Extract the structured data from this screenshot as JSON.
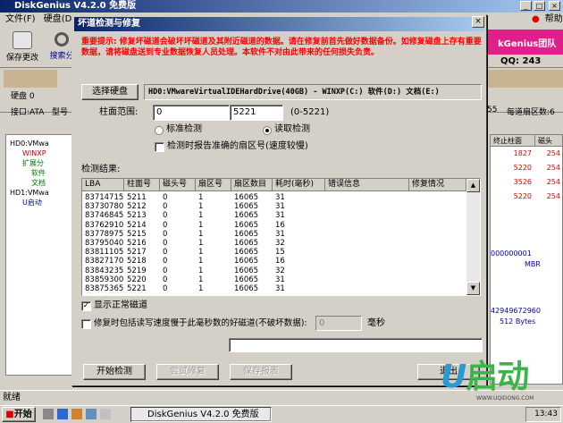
{
  "app": {
    "title": "DiskGenius V4.2.0 免费版",
    "menu": [
      "文件(F)",
      "硬盘(D)"
    ],
    "help": "帮助",
    "tools": [
      "保存更改",
      "搜索分"
    ],
    "disk_label": "硬盘 0",
    "iface": "接口:ATA",
    "model": "型号",
    "banner_text": "kGenius团队",
    "qq": "QQ: 243",
    "right_cols": [
      "终止柱面",
      "磁头"
    ],
    "right_rows": [
      [
        "1827",
        "254"
      ],
      [
        "5220",
        "254"
      ],
      [
        "3526",
        "254"
      ],
      [
        "5220",
        "254"
      ]
    ],
    "right_extra": [
      "55",
      "每道扇区数:6"
    ],
    "right_info": [
      "000000001",
      "MBR",
      "42949672960",
      "512 Bytes"
    ],
    "tree": [
      "HD0:VMwa",
      "WINXP",
      "扩展分",
      "软件",
      "文档",
      "HD1:VMwa",
      "U启动"
    ],
    "status": "就绪"
  },
  "dialog": {
    "title": "坏道检测与修复",
    "close": "×",
    "warning": "重要提示: 修复坏磁道会破坏坏磁道及其附近磁道的数据。请在修复前首先做好数据备份。如修复磁盘上存有重要数据，请将磁盘送到专业数据恢复人员处理。本软件不对由此带来的任何损失负责。",
    "select_disk": "选择硬盘",
    "disk_name": "HD0:VMwareVirtualIDEHardDrive(40GB) - WINXP(C:) 软件(D:) 文档(E:)",
    "cyl_label": "柱面范围:",
    "cyl_from": "0",
    "arrow": "-->",
    "cyl_to": "5221",
    "cyl_range": "(0-5221)",
    "mode_std": "标准检测",
    "mode_read": "读取检测",
    "report_slow": "检测时报告准确的扇区号(速度较慢)",
    "result_label": "检测结果:",
    "columns": [
      "LBA",
      "柱面号",
      "磁头号",
      "扇区号",
      "扇区数目",
      "耗时(毫秒)",
      "错误信息",
      "修复情况"
    ],
    "rows": [
      [
        "83714715",
        "5211",
        "0",
        "1",
        "16065",
        "31",
        "",
        ""
      ],
      [
        "83730780",
        "5212",
        "0",
        "1",
        "16065",
        "31",
        "",
        ""
      ],
      [
        "83746845",
        "5213",
        "0",
        "1",
        "16065",
        "31",
        "",
        ""
      ],
      [
        "83762910",
        "5214",
        "0",
        "1",
        "16065",
        "16",
        "",
        ""
      ],
      [
        "83778975",
        "5215",
        "0",
        "1",
        "16065",
        "31",
        "",
        ""
      ],
      [
        "83795040",
        "5216",
        "0",
        "1",
        "16065",
        "32",
        "",
        ""
      ],
      [
        "83811105",
        "5217",
        "0",
        "1",
        "16065",
        "15",
        "",
        ""
      ],
      [
        "83827170",
        "5218",
        "0",
        "1",
        "16065",
        "16",
        "",
        ""
      ],
      [
        "83843235",
        "5219",
        "0",
        "1",
        "16065",
        "32",
        "",
        ""
      ],
      [
        "83859300",
        "5220",
        "0",
        "1",
        "16065",
        "31",
        "",
        ""
      ],
      [
        "83875365",
        "5221",
        "0",
        "1",
        "16065",
        "31",
        "",
        ""
      ]
    ],
    "show_normal": "显示正常磁道",
    "repair_prefix": "修复时包括读写速度慢于此毫秒数的好磁道(不破坏数据):",
    "repair_ms": "0",
    "ms_unit": "毫秒",
    "btn_start": "开始检测",
    "btn_try": "尝试修复",
    "btn_save": "保存报表",
    "btn_exit": "退出"
  },
  "taskbar": {
    "start": "开始",
    "task": "DiskGenius V4.2.0 免费版",
    "clock": "13:43"
  },
  "logo": {
    "text": "U启动",
    "url": "WWW.UQIDONG.COM"
  }
}
